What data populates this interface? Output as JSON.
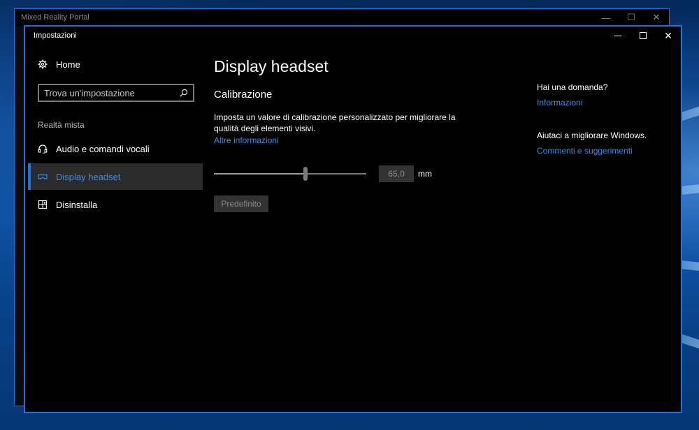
{
  "back_window": {
    "title": "Mixed Reality Portal",
    "controls": {
      "minimize": "—",
      "maximize": "☐",
      "close": "✕"
    }
  },
  "window": {
    "title": "Impostazioni",
    "controls": {
      "close": "✕"
    }
  },
  "sidebar": {
    "home_label": "Home",
    "search_placeholder": "Trova un'impostazione",
    "section_label": "Realtà mista",
    "items": [
      {
        "label": "Audio e comandi vocali",
        "icon": "headset-icon",
        "active": false
      },
      {
        "label": "Display headset",
        "icon": "vr-headset-icon",
        "active": true
      },
      {
        "label": "Disinstalla",
        "icon": "uninstall-icon",
        "active": false
      }
    ]
  },
  "main": {
    "title": "Display headset",
    "section_title": "Calibrazione",
    "description": "Imposta un valore di calibrazione personalizzato per migliorare la qualità degli elementi visivi.",
    "more_info_link": "Altre informazioni",
    "slider": {
      "value_text": "65,0",
      "unit": "mm",
      "fraction": 0.6
    },
    "default_button": "Predefinito"
  },
  "right": {
    "question": "Hai una domanda?",
    "question_link": "Informazioni",
    "improve": "Aiutaci a migliorare Windows.",
    "improve_link": "Commenti e suggerimenti"
  },
  "colors": {
    "accent": "#1a73e0",
    "link": "#3b8eea",
    "background": "#000000",
    "active_item_bg": "#2b2b2b"
  }
}
